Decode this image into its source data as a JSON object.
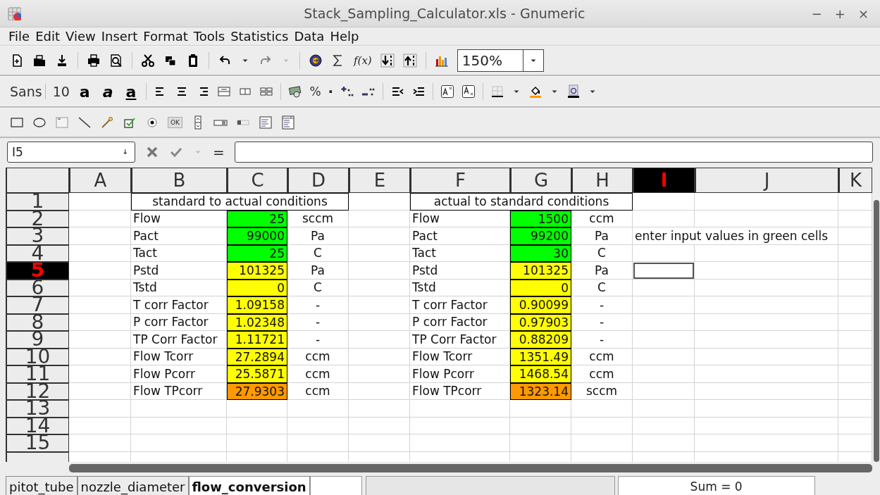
{
  "window": {
    "title": "Stack_Sampling_Calculator.xls - Gnumeric",
    "controls": [
      "−",
      "+",
      "×"
    ]
  },
  "menu": [
    "File",
    "Edit",
    "View",
    "Insert",
    "Format",
    "Tools",
    "Statistics",
    "Data",
    "Help"
  ],
  "toolbar": {
    "function_label": "f(x)",
    "zoom": "150%"
  },
  "format_toolbar": {
    "font": "Sans",
    "size": "10",
    "bold": "a",
    "italic": "a",
    "underline": "a",
    "percent": "%",
    "thousands": "·"
  },
  "object_toolbar": {
    "button_label": "OK"
  },
  "formula_bar": {
    "cell_reference": "I5",
    "equals": "="
  },
  "sheet": {
    "columns": [
      {
        "label": "A",
        "selected": false
      },
      {
        "label": "B",
        "selected": false
      },
      {
        "label": "C",
        "selected": false
      },
      {
        "label": "D",
        "selected": false
      },
      {
        "label": "E",
        "selected": false
      },
      {
        "label": "F",
        "selected": false
      },
      {
        "label": "G",
        "selected": false
      },
      {
        "label": "H",
        "selected": false
      },
      {
        "label": "I",
        "selected": true
      },
      {
        "label": "J",
        "selected": false
      },
      {
        "label": "K",
        "selected": false
      }
    ],
    "rows": [
      {
        "label": "1",
        "selected": false
      },
      {
        "label": "2",
        "selected": false
      },
      {
        "label": "3",
        "selected": false
      },
      {
        "label": "4",
        "selected": false
      },
      {
        "label": "5",
        "selected": true
      },
      {
        "label": "6",
        "selected": false
      },
      {
        "label": "7",
        "selected": false
      },
      {
        "label": "8",
        "selected": false
      },
      {
        "label": "9",
        "selected": false
      },
      {
        "label": "10",
        "selected": false
      },
      {
        "label": "11",
        "selected": false
      },
      {
        "label": "12",
        "selected": false
      },
      {
        "label": "13",
        "selected": false
      },
      {
        "label": "14",
        "selected": false
      },
      {
        "label": "15",
        "selected": false
      }
    ],
    "tables": [
      {
        "title": "standard to actual conditions",
        "rows": [
          {
            "label": "Flow",
            "value": "25",
            "unit": "sccm",
            "color": "#00ff00"
          },
          {
            "label": "Pact",
            "value": "99000",
            "unit": "Pa",
            "color": "#00ff00"
          },
          {
            "label": "Tact",
            "value": "25",
            "unit": "C",
            "color": "#00ff00"
          },
          {
            "label": "Pstd",
            "value": "101325",
            "unit": "Pa",
            "color": "#ffff00"
          },
          {
            "label": "Tstd",
            "value": "0",
            "unit": "C",
            "color": "#ffff00"
          },
          {
            "label": "T corr Factor",
            "value": "1.09158",
            "unit": "-",
            "color": "#ffff00"
          },
          {
            "label": "P corr Factor",
            "value": "1.02348",
            "unit": "-",
            "color": "#ffff00"
          },
          {
            "label": "TP Corr Factor",
            "value": "1.11721",
            "unit": "-",
            "color": "#ffff00"
          },
          {
            "label": "Flow Tcorr",
            "value": "27.2894",
            "unit": "ccm",
            "color": "#ffff00"
          },
          {
            "label": "Flow Pcorr",
            "value": "25.5871",
            "unit": "ccm",
            "color": "#ffff00"
          },
          {
            "label": "Flow TPcorr",
            "value": "27.9303",
            "unit": "ccm",
            "color": "#ff9900"
          }
        ]
      },
      {
        "title": "actual to standard conditions",
        "rows": [
          {
            "label": "Flow",
            "value": "1500",
            "unit": "ccm",
            "color": "#00ff00"
          },
          {
            "label": "Pact",
            "value": "99200",
            "unit": "Pa",
            "color": "#00ff00"
          },
          {
            "label": "Tact",
            "value": "30",
            "unit": "C",
            "color": "#00ff00"
          },
          {
            "label": "Pstd",
            "value": "101325",
            "unit": "Pa",
            "color": "#ffff00"
          },
          {
            "label": "Tstd",
            "value": "0",
            "unit": "C",
            "color": "#ffff00"
          },
          {
            "label": "T corr Factor",
            "value": "0.90099",
            "unit": "-",
            "color": "#ffff00"
          },
          {
            "label": "P corr Factor",
            "value": "0.97903",
            "unit": "-",
            "color": "#ffff00"
          },
          {
            "label": "TP Corr Factor",
            "value": "0.88209",
            "unit": "-",
            "color": "#ffff00"
          },
          {
            "label": "Flow Tcorr",
            "value": "1351.49",
            "unit": "ccm",
            "color": "#ffff00"
          },
          {
            "label": "Flow Pcorr",
            "value": "1468.54",
            "unit": "ccm",
            "color": "#ffff00"
          },
          {
            "label": "Flow TPcorr",
            "value": "1323.14",
            "unit": "sccm",
            "color": "#ff9900"
          }
        ]
      }
    ],
    "note": "enter input values in green cells"
  },
  "sheet_tabs": [
    {
      "label": "pitot_tube",
      "selected": false
    },
    {
      "label": "nozzle_diameter",
      "selected": false
    },
    {
      "label": "flow_conversion",
      "selected": true
    }
  ],
  "status": "Sum = 0"
}
